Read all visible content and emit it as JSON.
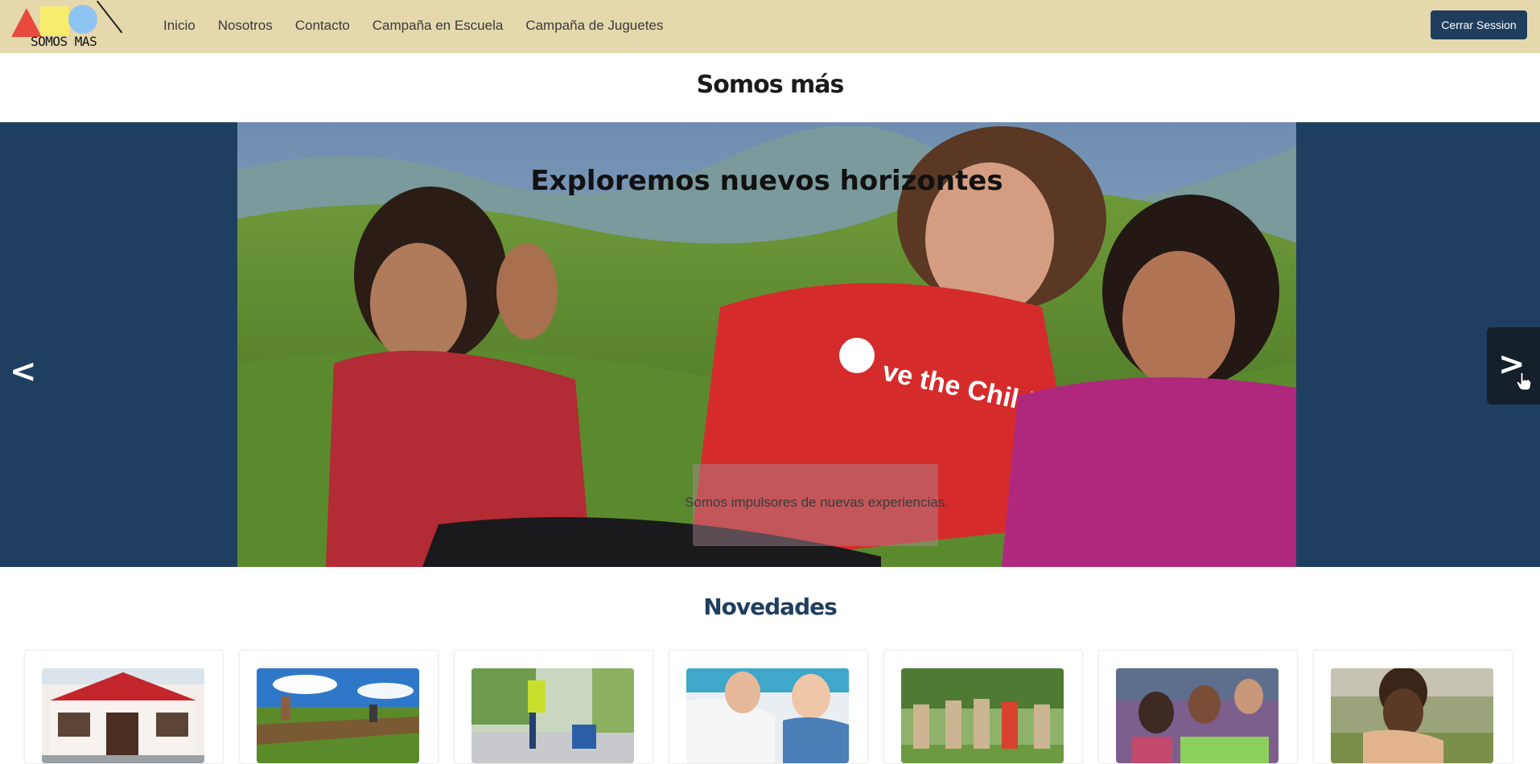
{
  "navbar": {
    "logo_text": "SOMOS MAS",
    "links": [
      "Inicio",
      "Nosotros",
      "Contacto",
      "Campaña en Escuela",
      "Campaña de Juguetes"
    ],
    "logout_label": "Cerrar Session"
  },
  "page_title": "Somos más",
  "carousel": {
    "heading": "Exploremos nuevos horizontes",
    "caption": "Somos impulsores de nuevas experiencias.",
    "prev_label": "<",
    "next_label": ">"
  },
  "news": {
    "title": "Novedades",
    "items": [
      {
        "image": "community-center-building"
      },
      {
        "image": "farm-field-workers"
      },
      {
        "image": "street-cleaning-volunteers"
      },
      {
        "image": "doctor-examining-child"
      },
      {
        "image": "children-sack-race"
      },
      {
        "image": "kids-classroom-activity"
      },
      {
        "image": "woman-holding-child"
      }
    ]
  },
  "colors": {
    "navbar_bg": "#e5d8ad",
    "button_bg": "#1f3e5e",
    "carousel_bg": "#1f3f60",
    "next_button_bg": "#15202b",
    "section_title": "#1f3f60"
  }
}
